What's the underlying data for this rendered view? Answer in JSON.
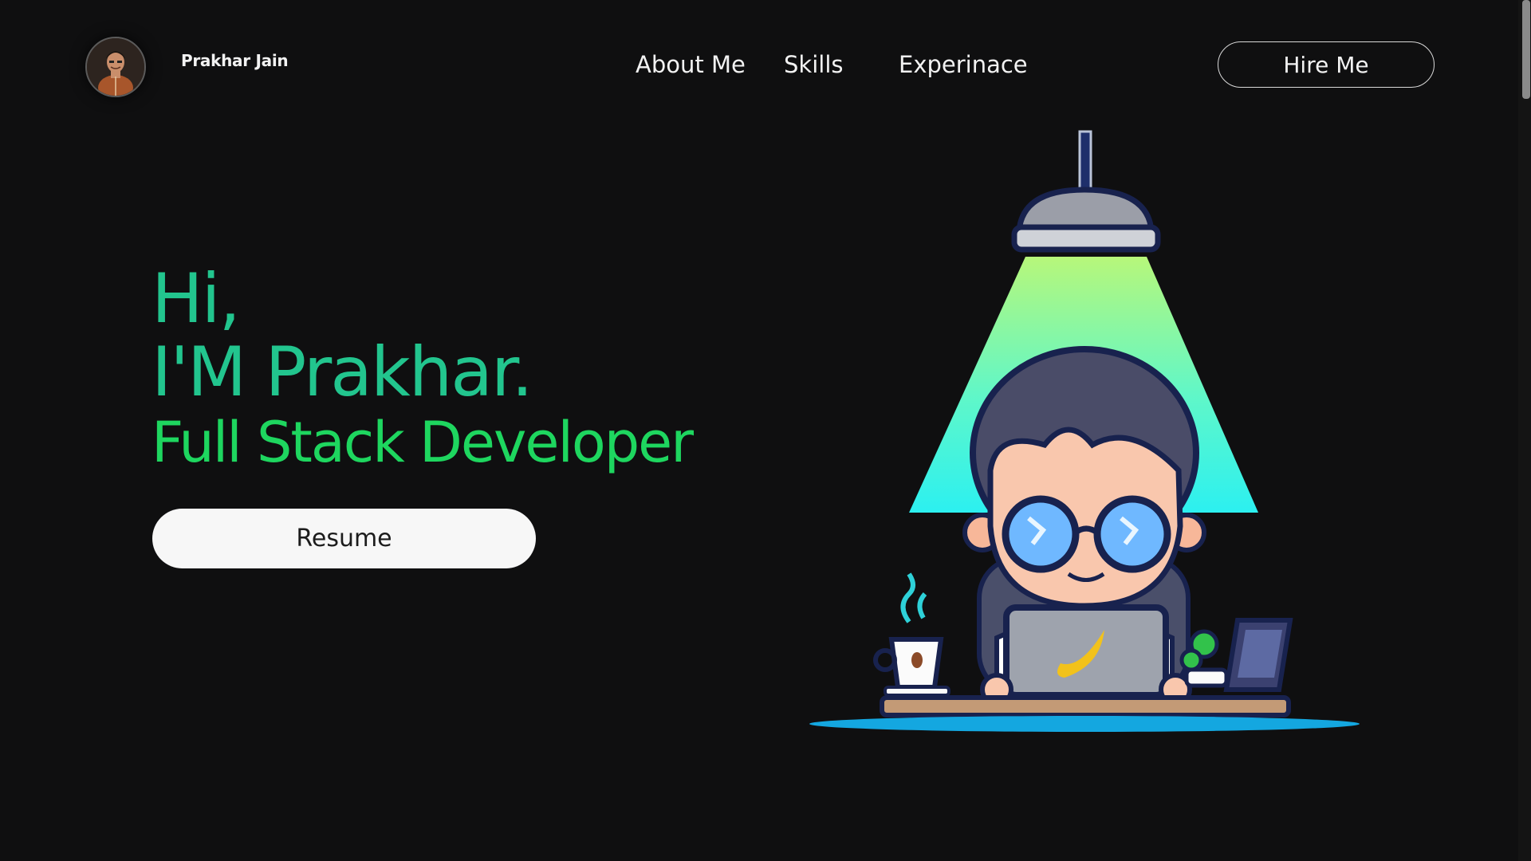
{
  "header": {
    "brand_name": "Prakhar Jain",
    "avatar_icon": "profile-photo",
    "nav": [
      "About Me",
      "Skills",
      "Experinace"
    ],
    "hire_button": "Hire Me"
  },
  "hero": {
    "greeting": "Hi,",
    "name_line": "I'M Prakhar.",
    "role": "Full Stack Developer",
    "resume_button": "Resume"
  },
  "colors": {
    "background": "#0f0f10",
    "accent_green": "#22c58e",
    "role_green": "#1ed65f",
    "button_bg": "#f7f7f7"
  },
  "illustration": {
    "icon": "developer-at-laptop-under-lamp-illustration"
  }
}
